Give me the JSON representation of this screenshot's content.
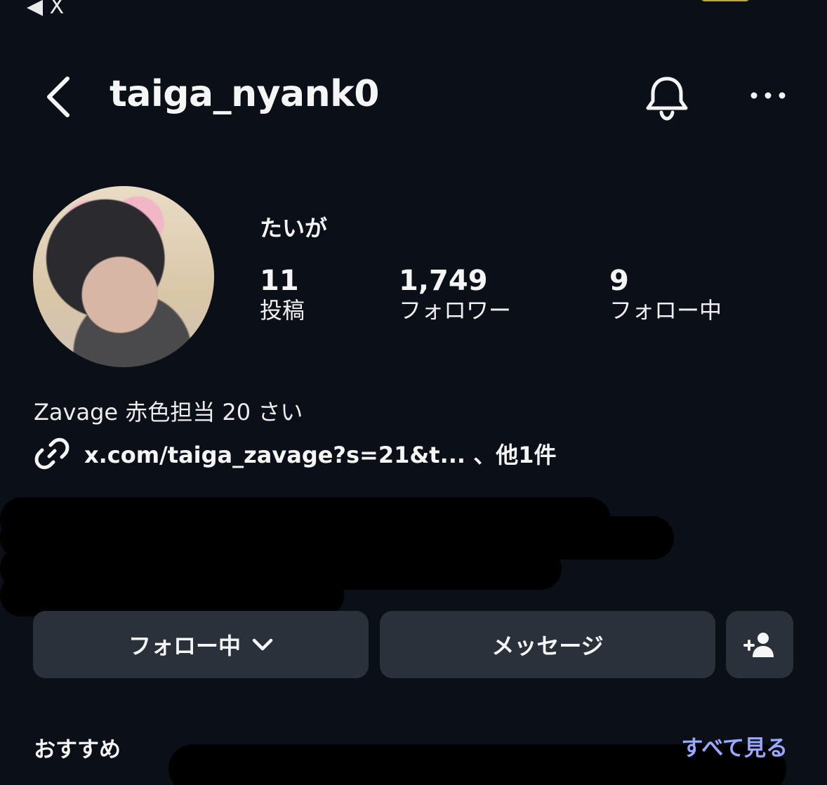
{
  "status": {
    "back_label": "◀ X"
  },
  "header": {
    "username": "taiga_nyank0"
  },
  "profile": {
    "display_name": "たいが",
    "stats": [
      {
        "value": "11",
        "label": "投稿"
      },
      {
        "value": "1,749",
        "label": "フォロワー"
      },
      {
        "value": "9",
        "label": "フォロー中"
      }
    ],
    "bio": "Zavage 赤色担当 20 さい",
    "link": "x.com/taiga_zavage?s=21&t... 、他1件"
  },
  "buttons": {
    "following_label": "フォロー中",
    "message_label": "メッセージ"
  },
  "suggestions": {
    "title": "おすすめ",
    "see_all": "すべて見る"
  },
  "icons": {
    "back": "chevron-left-icon",
    "bell": "bell-icon",
    "more": "more-horizontal-icon",
    "link": "link-icon",
    "chevron": "chevron-down-icon",
    "add_user": "add-user-icon"
  },
  "colors": {
    "background": "#0b0f17",
    "button": "#2b313b",
    "link_accent": "#9aa9ff"
  }
}
